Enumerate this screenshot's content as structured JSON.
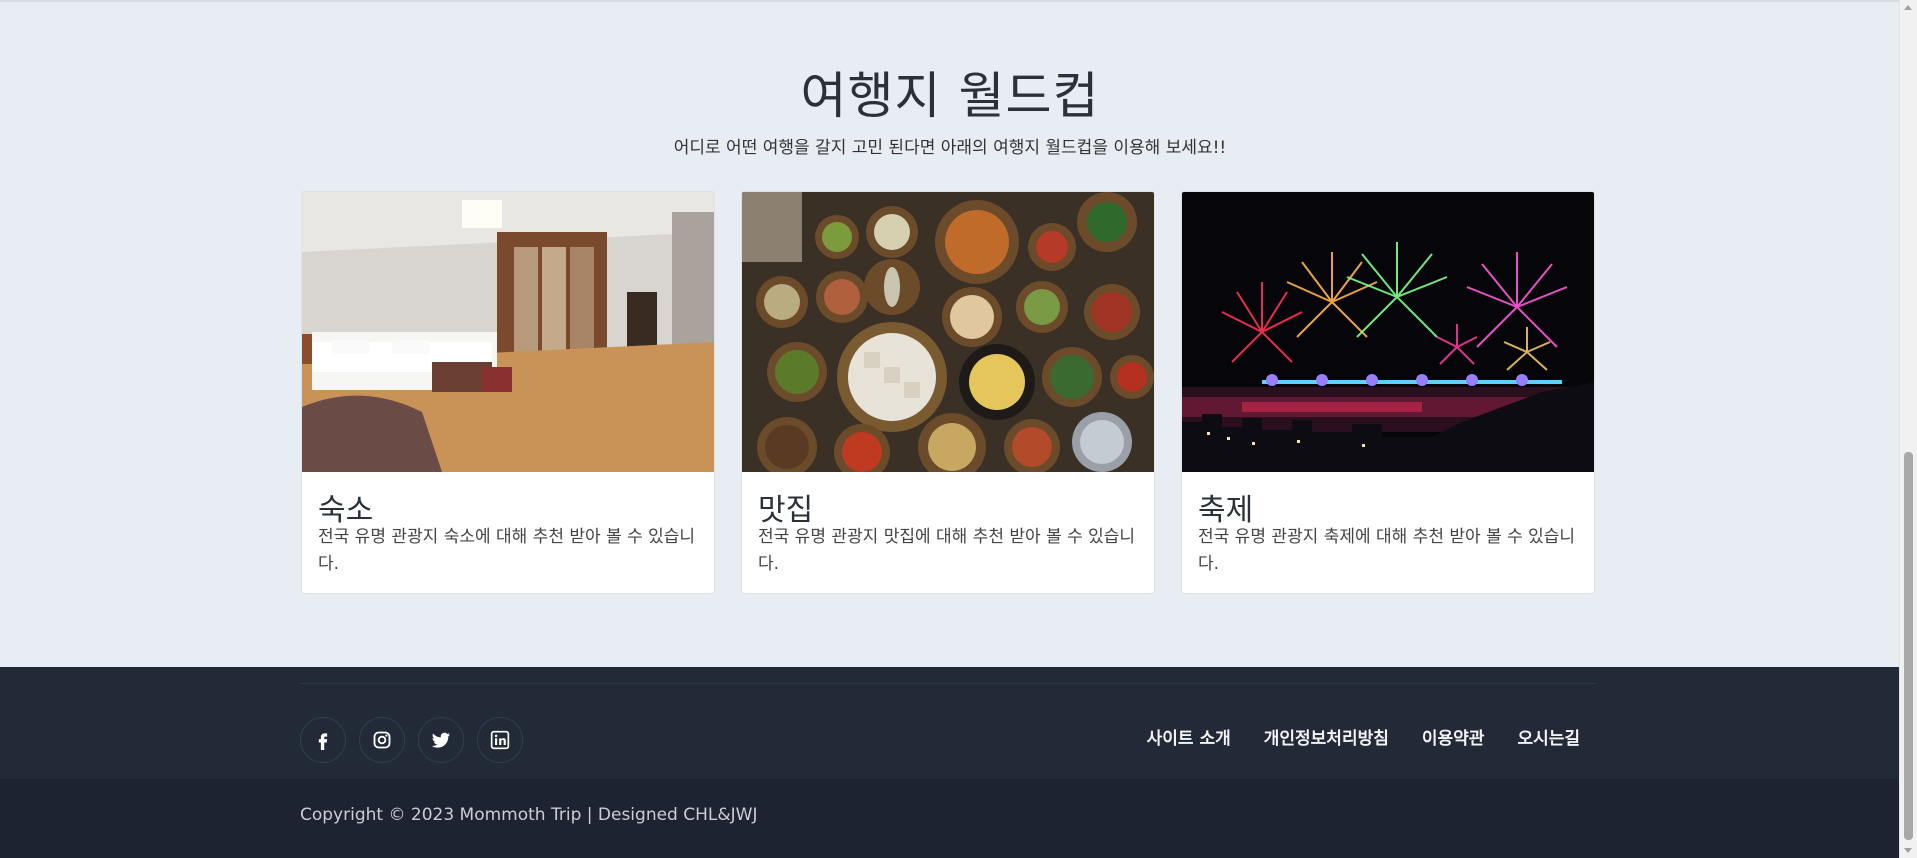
{
  "section": {
    "title": "여행지 월드컵",
    "subtitle": "어디로 어떤 여행을 갈지 고민 된다면 아래의 여행지 월드컵을 이용해 보세요!!"
  },
  "cards": [
    {
      "title": "숙소",
      "text": "전국 유명 관광지 숙소에 대해 추천 받아 볼 수 있습니다."
    },
    {
      "title": "맛집",
      "text": "전국 유명 관광지 맛집에 대해 추천 받아 볼 수 있습니다."
    },
    {
      "title": "축제",
      "text": "전국 유명 관광지 축제에 대해 추천 받아 볼 수 있습니다."
    }
  ],
  "footer": {
    "social_icons": [
      "facebook-icon",
      "instagram-icon",
      "twitter-icon",
      "linkedin-icon"
    ],
    "links": [
      "사이트 소개",
      "개인정보처리방침",
      "이용약관",
      "오시는길"
    ],
    "copyright": "Copyright © 2023 Mommoth Trip | Designed CHL&JWJ"
  },
  "colors": {
    "page_bg": "#e8edf4",
    "footer_bg": "#212a36",
    "footer_bottom_bg": "#1d2330"
  }
}
